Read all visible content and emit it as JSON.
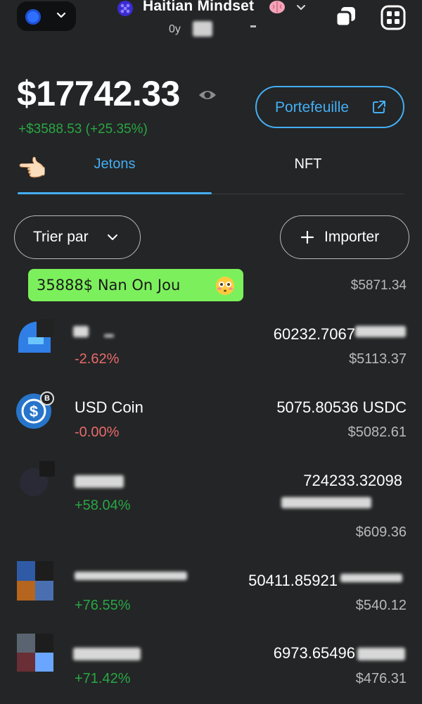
{
  "header": {
    "account_name": "Haitian Mindset",
    "account_address": "0y",
    "network_icon": "network-dot-icon",
    "copy_icon": "copy-icon",
    "scan_icon": "scan-icon"
  },
  "balance": {
    "total": "$17742.33",
    "change": "+$3588.53 (+25.35%)",
    "portfolio_label": "Portefeuille"
  },
  "tabs": {
    "tokens_label": "Jetons",
    "nft_label": "NFT",
    "hand_emoji": "👈🏻"
  },
  "actions": {
    "sort_label": "Trier par",
    "import_label": "Importer"
  },
  "promo": {
    "text": "35888$ Nan On Jou",
    "fiat": "$5871.34"
  },
  "tokens": [
    {
      "name": "",
      "change": "-2.62%",
      "amount": "60232.7067",
      "fiat": "$5113.37"
    },
    {
      "name": "USD Coin",
      "change": "-0.00%",
      "amount": "5075.80536 USDC",
      "fiat": "$5082.61",
      "badge": "B"
    },
    {
      "name": "",
      "change": "+58.04%",
      "amount": "724233.32098",
      "fiat": "$609.36"
    },
    {
      "name": "",
      "change": "+76.55%",
      "amount": "50411.85921",
      "fiat": "$540.12"
    },
    {
      "name": "",
      "change": "+71.42%",
      "amount": "6973.65496",
      "fiat": "$476.31"
    }
  ],
  "colors": {
    "background": "#242526",
    "accent": "#43aef3",
    "positive": "#28a745",
    "negative": "#e86a6a",
    "promo_bg": "#7cf05c"
  }
}
